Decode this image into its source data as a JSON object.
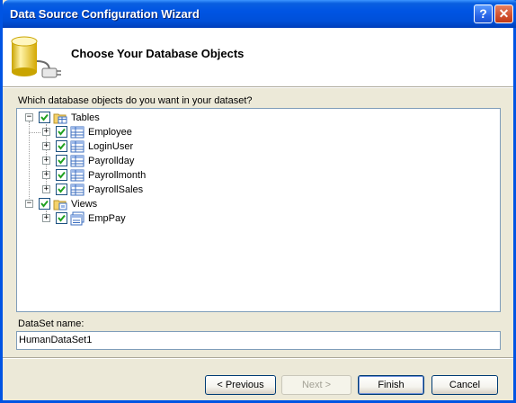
{
  "window": {
    "title": "Data Source Configuration Wizard",
    "help_glyph": "?",
    "close_glyph": "✕"
  },
  "header": {
    "title": "Choose Your Database Objects"
  },
  "prompt": "Which database objects do you want in your dataset?",
  "tree": {
    "groups": [
      {
        "label": "Tables",
        "expanded": true,
        "checked": true,
        "items": [
          "Employee",
          "LoginUser",
          "Payrollday",
          "Payrollmonth",
          "PayrollSales"
        ]
      },
      {
        "label": "Views",
        "expanded": true,
        "checked": true,
        "items": [
          "EmpPay"
        ]
      }
    ],
    "expand_glyph": "+",
    "collapse_glyph": "−"
  },
  "dataset": {
    "label": "DataSet name:",
    "value": "HumanDataSet1"
  },
  "buttons": {
    "previous": "< Previous",
    "next": "Next >",
    "finish": "Finish",
    "cancel": "Cancel"
  },
  "colors": {
    "title_bar": "#0054e3",
    "dialog_bg": "#ece9d8",
    "check_mark": "#21a121"
  }
}
